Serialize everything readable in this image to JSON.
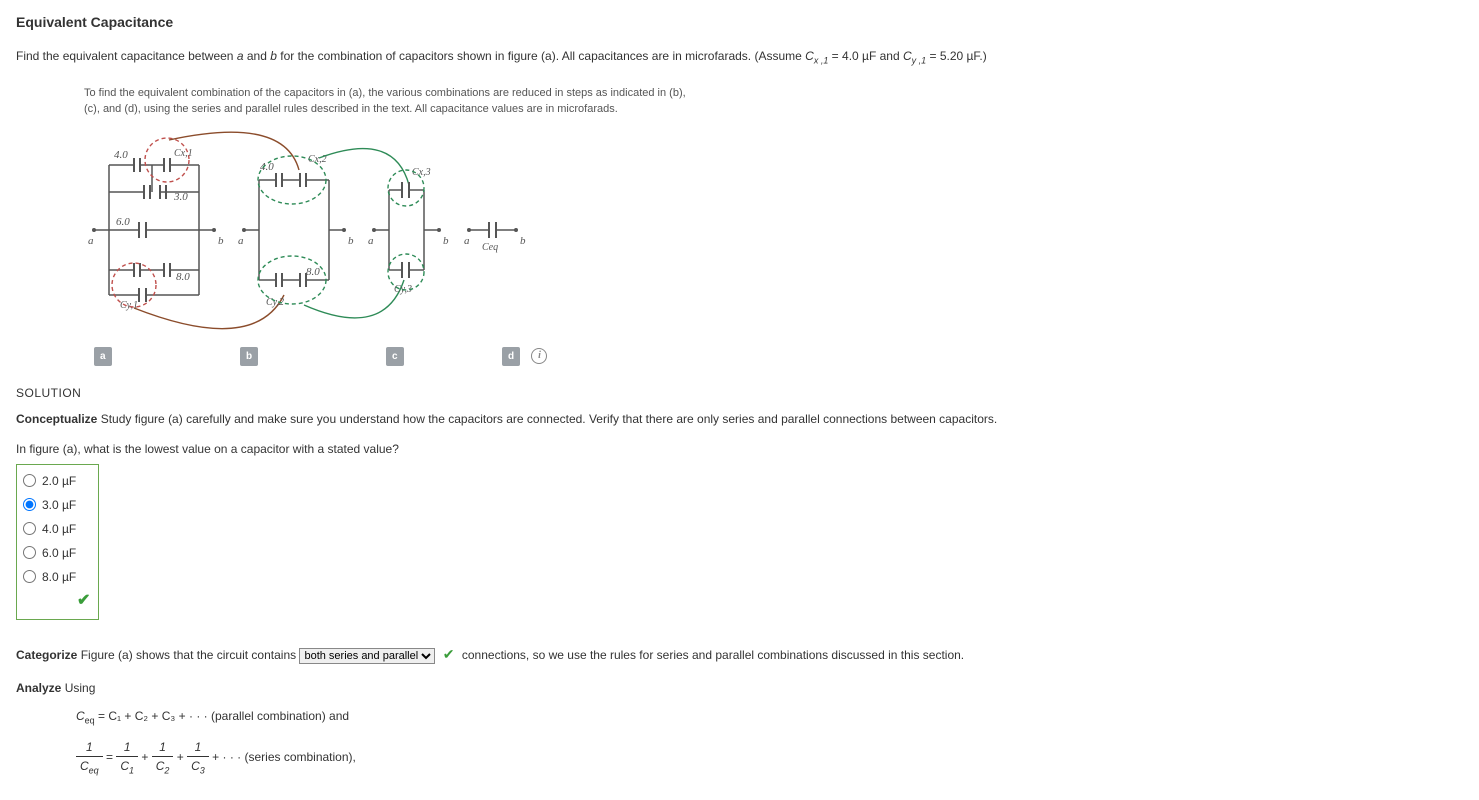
{
  "title": "Equivalent Capacitance",
  "problem": {
    "lead": "Find the equivalent capacitance between ",
    "a": "a",
    "mid1": " and ",
    "b": "b",
    "mid2": " for the combination of capacitors shown in figure (a). All capacitances are in microfarads. (Assume ",
    "cx_label": "C",
    "cx_sub": "x ,1",
    "cx_eq": " = 4.0 µF and ",
    "cy_label": "C",
    "cy_sub": "y ,1",
    "cy_eq": " = 5.20 µF.)"
  },
  "figure": {
    "caption": "To find the equivalent combination of the capacitors in (a), the various combinations are reduced in steps as indicated in (b), (c), and (d), using the series and parallel rules described in the text. All capacitance values are in microfarads.",
    "labels": [
      "a",
      "b",
      "c",
      "d"
    ],
    "info_aria": "info",
    "values": {
      "c40a": "4.0",
      "c30": "3.0",
      "c60": "6.0",
      "c80": "8.0",
      "cx1": "Cx,1",
      "cy1": "Cy,1",
      "c40b": "4.0",
      "c80b": "8.0",
      "cx2": "Cx,2",
      "cy2": "Cy,2",
      "cx3": "Cx,3",
      "cy3": "Cy,3",
      "ceq": "Ceq",
      "term_a": "a",
      "term_b": "b"
    }
  },
  "solution_head": "SOLUTION",
  "conceptualize": {
    "label": "Conceptualize",
    "text": " Study figure (a) carefully and make sure you understand how the capacitors are connected. Verify that there are only series and parallel connections between capacitors."
  },
  "question1": "In figure (a), what is the lowest value on a capacitor with a stated value?",
  "options": [
    {
      "label": "2.0 µF",
      "checked": false
    },
    {
      "label": "3.0 µF",
      "checked": true
    },
    {
      "label": "4.0 µF",
      "checked": false
    },
    {
      "label": "6.0 µF",
      "checked": false
    },
    {
      "label": "8.0 µF",
      "checked": false
    }
  ],
  "categorize": {
    "label": "Categorize",
    "pre": " Figure (a) shows that the circuit contains ",
    "select_value": "both series and parallel",
    "post": " connections, so we use the rules for series and parallel combinations discussed in this section."
  },
  "analyze": {
    "label": "Analyze",
    "using": " Using",
    "eq1_lhs": "C",
    "eq1_lhs_sub": "eq",
    "eq1_rhs": " = C₁ + C₂ + C₃ + · · ·  (parallel combination) and",
    "eq2_tail": " + · · ·  (series combination),"
  }
}
